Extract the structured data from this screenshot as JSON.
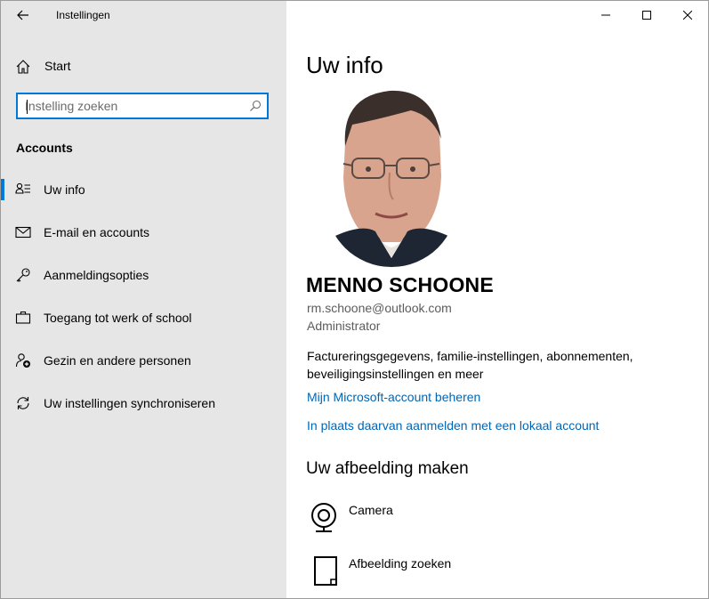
{
  "window": {
    "title": "Instellingen",
    "controls": [
      "minimize",
      "maximize",
      "close"
    ]
  },
  "sidebar": {
    "home_label": "Start",
    "search": {
      "placeholder": "Instelling zoeken",
      "value": ""
    },
    "section_heading": "Accounts",
    "items": [
      {
        "label": "Uw info",
        "icon": "user-info-icon",
        "selected": true
      },
      {
        "label": "E-mail en accounts",
        "icon": "mail-icon",
        "selected": false
      },
      {
        "label": "Aanmeldingsopties",
        "icon": "key-icon",
        "selected": false
      },
      {
        "label": "Toegang tot werk of school",
        "icon": "briefcase-icon",
        "selected": false
      },
      {
        "label": "Gezin en andere personen",
        "icon": "add-person-icon",
        "selected": false
      },
      {
        "label": "Uw instellingen synchroniseren",
        "icon": "sync-icon",
        "selected": false
      }
    ]
  },
  "main": {
    "title": "Uw info",
    "user": {
      "name": "MENNO SCHOONE",
      "email": "rm.schoone@outlook.com",
      "role": "Administrator"
    },
    "description": "Factureringsgegevens, familie-instellingen, abonnementen, beveiligingsinstellingen en meer",
    "links": {
      "manage_account": "Mijn Microsoft-account beheren",
      "local_account": "In plaats daarvan aanmelden met een lokaal account"
    },
    "create_picture": {
      "heading": "Uw afbeelding maken",
      "options": [
        {
          "label": "Camera",
          "icon": "camera-icon"
        },
        {
          "label": "Afbeelding zoeken",
          "icon": "browse-file-icon"
        }
      ]
    }
  },
  "colors": {
    "accent": "#0078d7",
    "link": "#0066b4",
    "sidebar_bg": "#e6e6e6"
  }
}
